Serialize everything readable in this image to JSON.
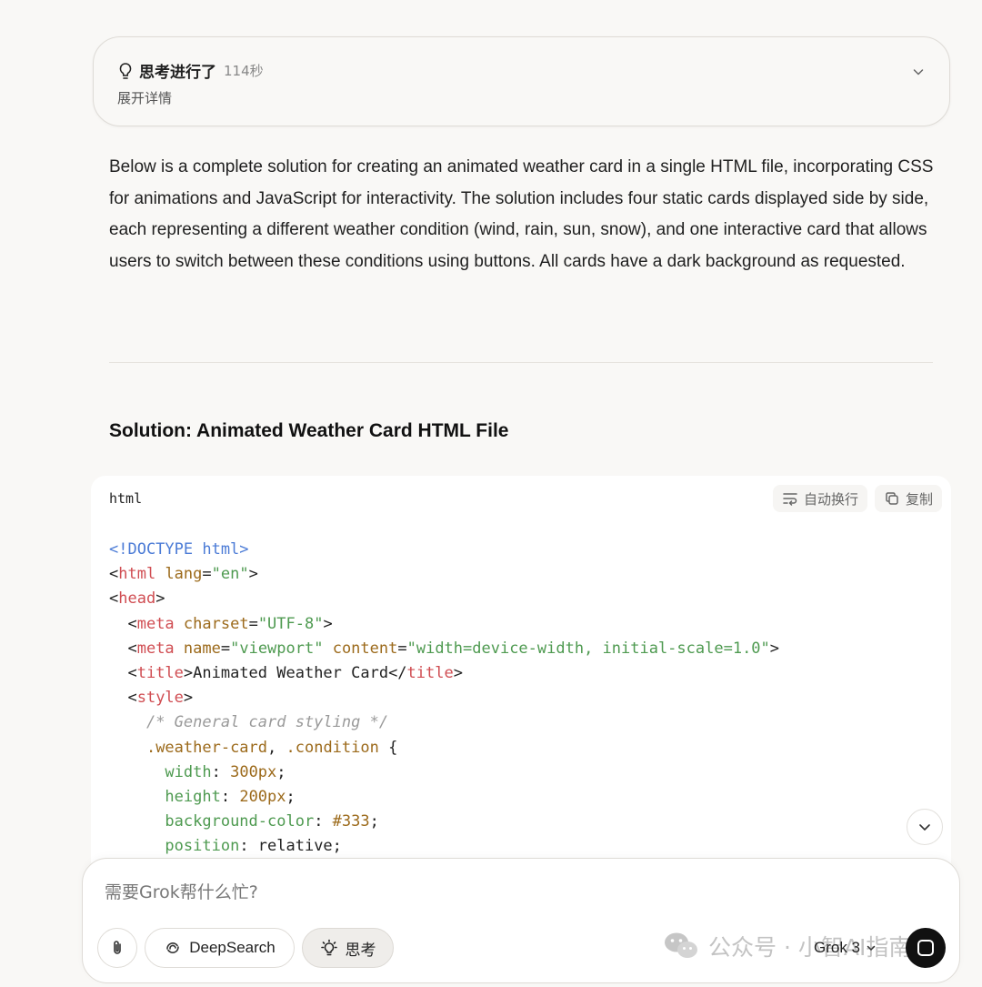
{
  "thinking": {
    "title": "思考进行了",
    "duration": "114秒",
    "expand_label": "展开详情"
  },
  "answer": {
    "intro": "Below is a complete solution for creating an animated weather card in a single HTML file, incorporating CSS for animations and JavaScript for interactivity. The solution includes four static cards displayed side by side, each representing a different weather condition (wind, rain, sun, snow), and one interactive card that allows users to switch between these conditions using buttons. All cards have a dark background as requested.",
    "section_title": "Solution: Animated Weather Card HTML File"
  },
  "code_block": {
    "language": "html",
    "wrap_label": "自动换行",
    "copy_label": "复制",
    "lines": [
      [
        {
          "t": "<!DOCTYPE html>",
          "c": "kw"
        }
      ],
      [
        {
          "t": "<",
          "c": ""
        },
        {
          "t": "html",
          "c": "tag"
        },
        {
          "t": " lang",
          "c": "attr"
        },
        {
          "t": "=",
          "c": ""
        },
        {
          "t": "\"en\"",
          "c": "str"
        },
        {
          "t": ">",
          "c": ""
        }
      ],
      [
        {
          "t": "<",
          "c": ""
        },
        {
          "t": "head",
          "c": "tag"
        },
        {
          "t": ">",
          "c": ""
        }
      ],
      [
        {
          "t": "  <",
          "c": ""
        },
        {
          "t": "meta",
          "c": "tag"
        },
        {
          "t": " charset",
          "c": "attr"
        },
        {
          "t": "=",
          "c": ""
        },
        {
          "t": "\"UTF-8\"",
          "c": "str"
        },
        {
          "t": ">",
          "c": ""
        }
      ],
      [
        {
          "t": "  <",
          "c": ""
        },
        {
          "t": "meta",
          "c": "tag"
        },
        {
          "t": " name",
          "c": "attr"
        },
        {
          "t": "=",
          "c": ""
        },
        {
          "t": "\"viewport\"",
          "c": "str"
        },
        {
          "t": " content",
          "c": "attr"
        },
        {
          "t": "=",
          "c": ""
        },
        {
          "t": "\"width=device-width, initial-scale=1.0\"",
          "c": "str"
        },
        {
          "t": ">",
          "c": ""
        }
      ],
      [
        {
          "t": "  <",
          "c": ""
        },
        {
          "t": "title",
          "c": "tag"
        },
        {
          "t": ">Animated Weather Card</",
          "c": ""
        },
        {
          "t": "title",
          "c": "tag"
        },
        {
          "t": ">",
          "c": ""
        }
      ],
      [
        {
          "t": "  <",
          "c": ""
        },
        {
          "t": "style",
          "c": "tag"
        },
        {
          "t": ">",
          "c": ""
        }
      ],
      [
        {
          "t": "    ",
          "c": ""
        },
        {
          "t": "/* General card styling */",
          "c": "cm"
        }
      ],
      [
        {
          "t": "    ",
          "c": ""
        },
        {
          "t": ".weather-card",
          "c": "sel"
        },
        {
          "t": ", ",
          "c": ""
        },
        {
          "t": ".condition",
          "c": "sel"
        },
        {
          "t": " {",
          "c": ""
        }
      ],
      [
        {
          "t": "      ",
          "c": ""
        },
        {
          "t": "width",
          "c": "prop"
        },
        {
          "t": ": ",
          "c": ""
        },
        {
          "t": "300px",
          "c": "val"
        },
        {
          "t": ";",
          "c": ""
        }
      ],
      [
        {
          "t": "      ",
          "c": ""
        },
        {
          "t": "height",
          "c": "prop"
        },
        {
          "t": ": ",
          "c": ""
        },
        {
          "t": "200px",
          "c": "val"
        },
        {
          "t": ";",
          "c": ""
        }
      ],
      [
        {
          "t": "      ",
          "c": ""
        },
        {
          "t": "background-color",
          "c": "prop"
        },
        {
          "t": ": ",
          "c": ""
        },
        {
          "t": "#333",
          "c": "val"
        },
        {
          "t": ";",
          "c": ""
        }
      ],
      [
        {
          "t": "      ",
          "c": ""
        },
        {
          "t": "position",
          "c": "prop"
        },
        {
          "t": ": relative;",
          "c": ""
        }
      ]
    ]
  },
  "composer": {
    "placeholder": "需要Grok帮什么忙?",
    "deepsearch_label": "DeepSearch",
    "think_label": "思考",
    "model_label": "Grok 3"
  },
  "watermark": {
    "text": "公众号 · 小智AI指南"
  }
}
